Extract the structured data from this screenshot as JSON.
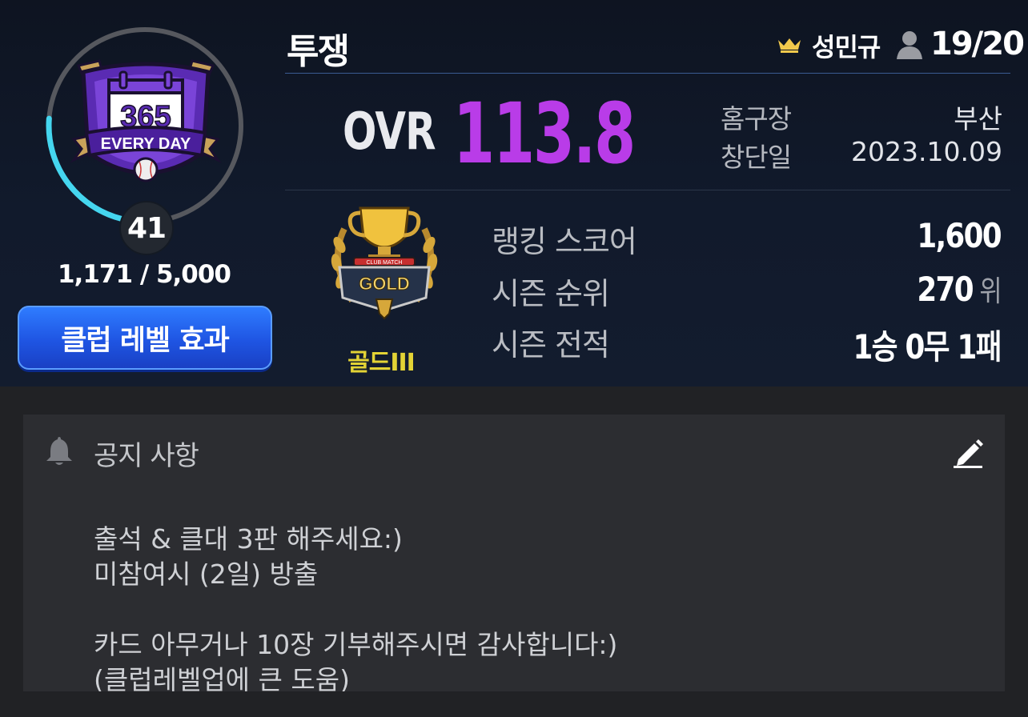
{
  "club": {
    "level": "41",
    "exp_text": "1,171 / 5,000",
    "exp_progress": 0.234,
    "level_button_label": "클럽 레벨 효과",
    "emblem": {
      "icon": "365-everyday-emblem-icon",
      "number": "365",
      "banner": "EVERY DAY"
    }
  },
  "header": {
    "club_name": "투쟁",
    "owner_icon": "crown-icon",
    "owner": "성민규",
    "member_icon": "person-icon",
    "members": "19/20"
  },
  "overview": {
    "ovr_label": "OVR",
    "ovr_value": "113.8",
    "stadium_label": "홈구장",
    "stadium_value": "부산",
    "founded_label": "창단일",
    "founded_value": "2023.10.09"
  },
  "league": {
    "badge_icon": "gold-trophy-icon",
    "badge_small_text": "CLUB MATCH",
    "badge_text": "GOLD",
    "name": "골드III"
  },
  "stats": {
    "ranking_label": "랭킹 스코어",
    "ranking_value": "1,600",
    "season_rank_label": "시즌 순위",
    "season_rank_value": "270",
    "season_rank_unit": "위",
    "record_label": "시즌 전적",
    "record_value": "1승 0무 1패"
  },
  "notice": {
    "icon": "bell-icon",
    "title": "공지 사항",
    "edit_icon": "pencil-icon",
    "lines": [
      "출석 & 클대 3판 해주세요:)",
      "미참여시 (2일) 방출",
      "",
      "카드 아무거나 10장 기부해주시면 감사합니다:)",
      "(클럽레벨업에 큰 도움)"
    ]
  },
  "colors": {
    "accent_purple": "#b93ce8",
    "progress_cyan": "#45d6ef",
    "league_gold": "#e3d335",
    "button_blue": "#2460ee"
  }
}
